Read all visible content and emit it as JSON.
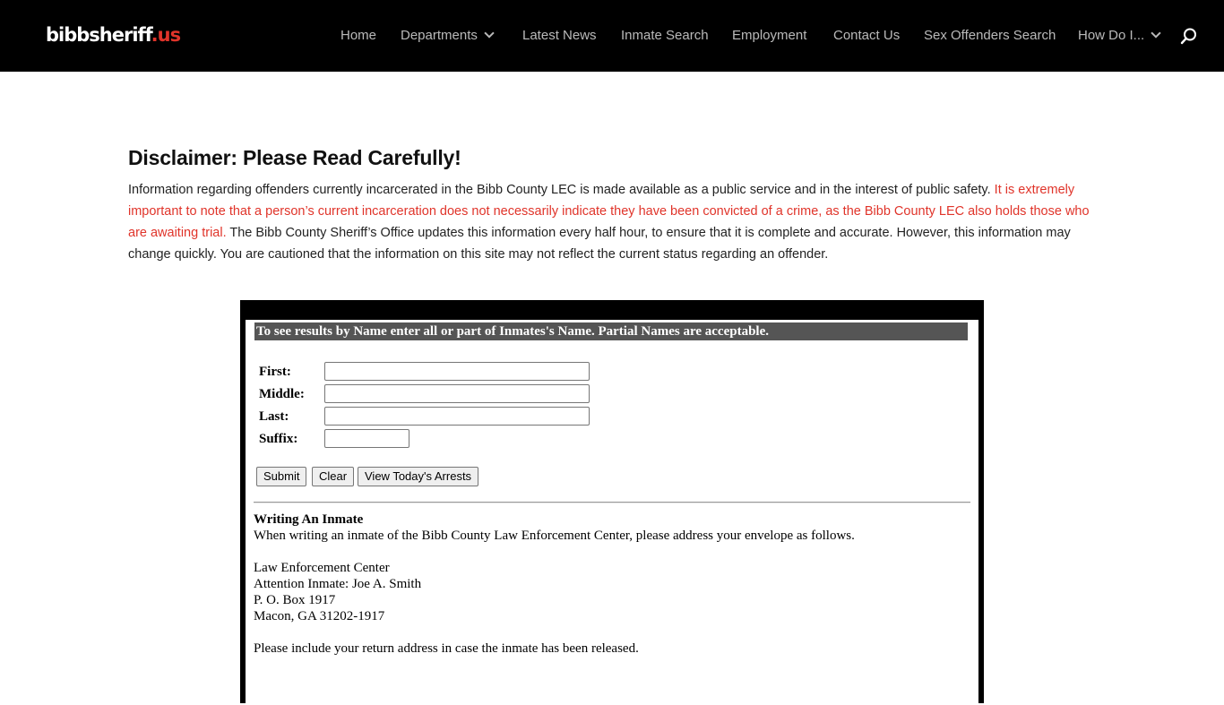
{
  "header": {
    "logo_main": "bibbsheriff",
    "logo_tld": ".us",
    "nav": [
      {
        "label": "Home"
      },
      {
        "label": "Departments"
      },
      {
        "label": "Latest News"
      },
      {
        "label": "Inmate Search"
      },
      {
        "label": "Employment"
      },
      {
        "label": "Contact Us"
      },
      {
        "label": "Sex Offenders Search"
      },
      {
        "label": "How Do I..."
      }
    ],
    "search_icon": "search-icon"
  },
  "disclaimer": {
    "title": "Disclaimer: Please Read Carefully!",
    "text_part1": "Information regarding offenders currently incarcerated in the Bibb County LEC is made available as a public service and in the interest of public safety. ",
    "text_part2_red": "It is extremely important to note that a person’s current incarceration does not necessarily indicate they have been convicted of a crime, as the Bibb County LEC also holds those who are awaiting trial.",
    "text_part3": " The Bibb County Sheriff’s Office updates this information every half hour, to ensure that it is complete and accurate. However, this information may change quickly. You are cautioned that the information on this site may not reflect the current status regarding an offender."
  },
  "search_form": {
    "header": "To see results by Name enter all or part of Inmates's Name. Partial Names are acceptable.",
    "fields": {
      "first_label": "First:",
      "first_value": "",
      "middle_label": "Middle:",
      "middle_value": "",
      "last_label": "Last:",
      "last_value": "",
      "suffix_label": "Suffix:",
      "suffix_value": ""
    },
    "buttons": {
      "submit": "Submit",
      "clear": "Clear",
      "todays_arrests": "View Today's Arrests"
    }
  },
  "writing": {
    "title": "Writing An Inmate",
    "intro": "When writing an inmate of the Bibb County Law Enforcement Center, please address your envelope as follows.",
    "address": [
      "Law Enforcement Center",
      "Attention Inmate: Joe A. Smith",
      "P. O. Box 1917",
      "Macon, GA 31202-1917"
    ],
    "note": "Please include your return address in case the inmate has been released."
  },
  "colors": {
    "header_bg": "#000000",
    "accent_red": "#e0342a",
    "panel_header_bg": "#555555"
  }
}
